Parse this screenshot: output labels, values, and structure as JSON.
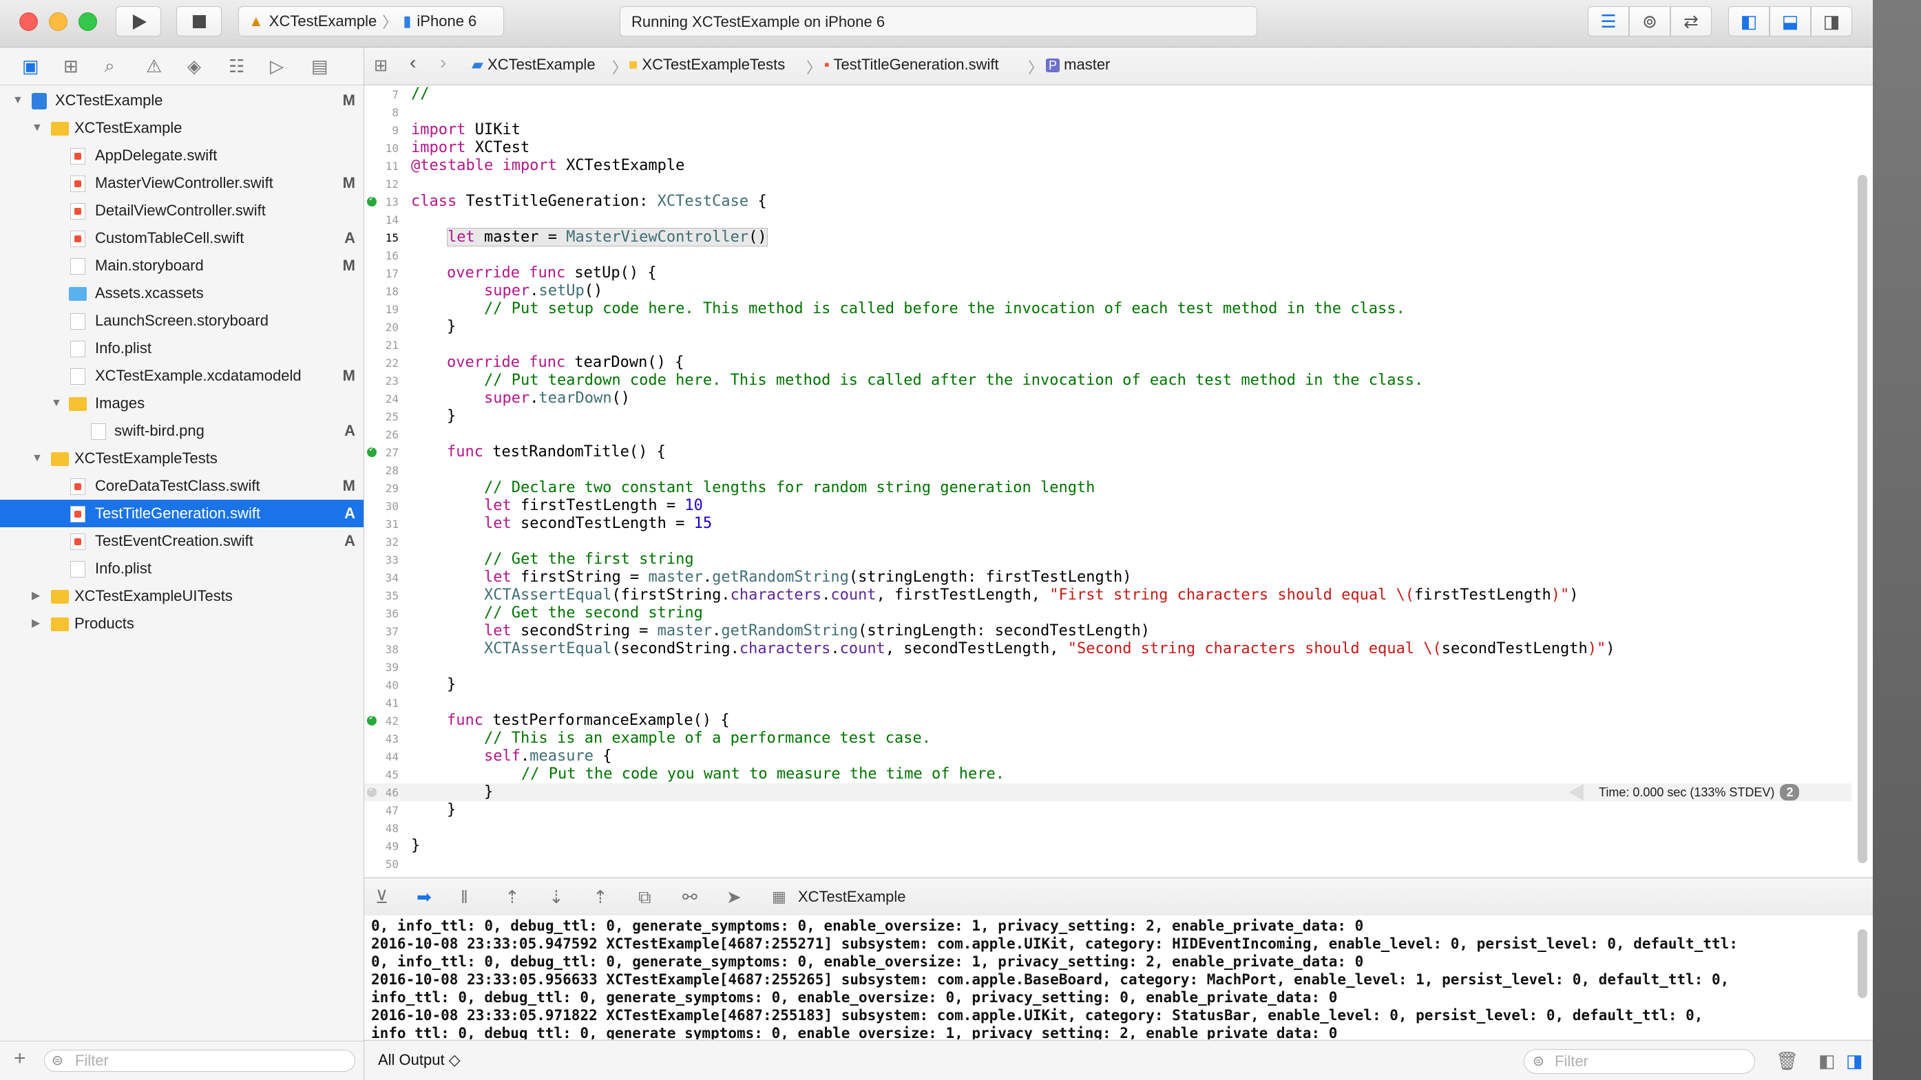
{
  "toolbar": {
    "scheme_target": "XCTestExample",
    "scheme_device": "iPhone 6",
    "activity": "Running XCTestExample on iPhone 6",
    "accent": "#1a73e8"
  },
  "navigator": {
    "icons": [
      "folder-icon",
      "hierarchy-icon",
      "search-icon",
      "warning-icon",
      "test-icon",
      "debug-icon",
      "breakpoint-icon",
      "report-icon"
    ],
    "items": [
      {
        "label": "XCTestExample",
        "status": "M"
      },
      {
        "label": "XCTestExample",
        "status": ""
      },
      {
        "label": "AppDelegate.swift",
        "status": ""
      },
      {
        "label": "MasterViewController.swift",
        "status": "M"
      },
      {
        "label": "DetailViewController.swift",
        "status": ""
      },
      {
        "label": "CustomTableCell.swift",
        "status": "A"
      },
      {
        "label": "Main.storyboard",
        "status": "M"
      },
      {
        "label": "Assets.xcassets",
        "status": ""
      },
      {
        "label": "LaunchScreen.storyboard",
        "status": ""
      },
      {
        "label": "Info.plist",
        "status": ""
      },
      {
        "label": "XCTestExample.xcdatamodeld",
        "status": "M"
      },
      {
        "label": "Images",
        "status": ""
      },
      {
        "label": "swift-bird.png",
        "status": "A"
      },
      {
        "label": "XCTestExampleTests",
        "status": ""
      },
      {
        "label": "CoreDataTestClass.swift",
        "status": "M"
      },
      {
        "label": "TestTitleGeneration.swift",
        "status": "A"
      },
      {
        "label": "TestEventCreation.swift",
        "status": "A"
      },
      {
        "label": "Info.plist",
        "status": ""
      },
      {
        "label": "XCTestExampleUITests",
        "status": ""
      },
      {
        "label": "Products",
        "status": ""
      }
    ],
    "filter_placeholder": "Filter"
  },
  "jumpbar": {
    "crumbs": [
      "XCTestExample",
      "XCTestExampleTests",
      "TestTitleGeneration.swift",
      "master"
    ]
  },
  "editor": {
    "line_numbers": [
      "7",
      "8",
      "9",
      "10",
      "11",
      "12",
      "13",
      "14",
      "15",
      "16",
      "17",
      "18",
      "19",
      "20",
      "21",
      "22",
      "23",
      "24",
      "25",
      "26",
      "27",
      "28",
      "29",
      "30",
      "31",
      "32",
      "33",
      "34",
      "35",
      "36",
      "37",
      "38",
      "39",
      "40",
      "41",
      "42",
      "43",
      "44",
      "45",
      "46",
      "47",
      "48",
      "49",
      "50"
    ],
    "code": {
      "l7": "//",
      "l9a": "import",
      "l9b": " UIKit",
      "l10a": "import",
      "l10b": " XCTest",
      "l11a": "@testable import",
      "l11b": " XCTestExample",
      "l13a": "class",
      "l13b": " TestTitleGeneration: ",
      "l13c": "XCTestCase",
      "l13d": " {",
      "l15a": "let",
      "l15b": " master = ",
      "l15c": "MasterViewController",
      "l15d": "()",
      "l17a": "override func",
      "l17b": " setUp() {",
      "l18a": "super",
      "l18b": ".",
      "l18c": "setUp",
      "l18d": "()",
      "l19": "// Put setup code here. This method is called before the invocation of each test method in the class.",
      "l20": "}",
      "l22a": "override func",
      "l22b": " tearDown() {",
      "l23": "// Put teardown code here. This method is called after the invocation of each test method in the class.",
      "l24a": "super",
      "l24b": ".",
      "l24c": "tearDown",
      "l24d": "()",
      "l25": "}",
      "l27a": "func",
      "l27b": " testRandomTitle() {",
      "l29": "// Declare two constant lengths for random string generation length",
      "l30a": "let",
      "l30b": " firstTestLength = ",
      "l30c": "10",
      "l31a": "let",
      "l31b": " secondTestLength = ",
      "l31c": "15",
      "l33": "// Get the first string",
      "l34a": "let",
      "l34b": " firstString = ",
      "l34c": "master",
      "l34d": ".",
      "l34e": "getRandomString",
      "l34f": "(stringLength: firstTestLength)",
      "l35a": "XCTAssertEqual",
      "l35b": "(firstString.",
      "l35c": "characters",
      "l35d": ".",
      "l35e": "count",
      "l35f": ", firstTestLength, ",
      "l35g": "\"First string characters should equal \\(",
      "l35h": "firstTestLength",
      "l35i": ")\"",
      "l35j": ")",
      "l36": "// Get the second string",
      "l37a": "let",
      "l37b": " secondString = ",
      "l37c": "master",
      "l37d": ".",
      "l37e": "getRandomString",
      "l37f": "(stringLength: secondTestLength)",
      "l38a": "XCTAssertEqual",
      "l38b": "(secondString.",
      "l38c": "characters",
      "l38d": ".",
      "l38e": "count",
      "l38f": ", secondTestLength, ",
      "l38g": "\"Second string characters should equal \\(",
      "l38h": "secondTestLength",
      "l38i": ")\"",
      "l38j": ")",
      "l40": "}",
      "l42a": "func",
      "l42b": " testPerformanceExample() {",
      "l43": "// This is an example of a performance test case.",
      "l44a": "self",
      "l44b": ".",
      "l44c": "measure",
      "l44d": " {",
      "l45": "// Put the code you want to measure the time of here.",
      "l46": "}",
      "l47": "}",
      "l49": "}"
    },
    "perf_result": "Time: 0.000 sec (133% STDEV)",
    "perf_badge": "2"
  },
  "debug": {
    "target": "XCTestExample",
    "console_lines": [
      "0, info_ttl: 0, debug_ttl: 0, generate_symptoms: 0, enable_oversize: 1, privacy_setting: 2, enable_private_data: 0",
      "2016-10-08 23:33:05.947592 XCTestExample[4687:255271] subsystem: com.apple.UIKit, category: HIDEventIncoming, enable_level: 0, persist_level: 0, default_ttl:",
      "0, info_ttl: 0, debug_ttl: 0, generate_symptoms: 0, enable_oversize: 1, privacy_setting: 2, enable_private_data: 0",
      "2016-10-08 23:33:05.956633 XCTestExample[4687:255265] subsystem: com.apple.BaseBoard, category: MachPort, enable_level: 1, persist_level: 0, default_ttl: 0,",
      "info_ttl: 0, debug_ttl: 0, generate_symptoms: 0, enable_oversize: 0, privacy_setting: 0, enable_private_data: 0",
      "2016-10-08 23:33:05.971822 XCTestExample[4687:255183] subsystem: com.apple.UIKit, category: StatusBar, enable_level: 0, persist_level: 0, default_ttl: 0,",
      "info_ttl: 0, debug_ttl: 0, generate_symptoms: 0, enable_oversize: 1, privacy_setting: 2, enable_private_data: 0"
    ],
    "output_selector": "All Output ◇",
    "filter_placeholder": "Filter"
  }
}
